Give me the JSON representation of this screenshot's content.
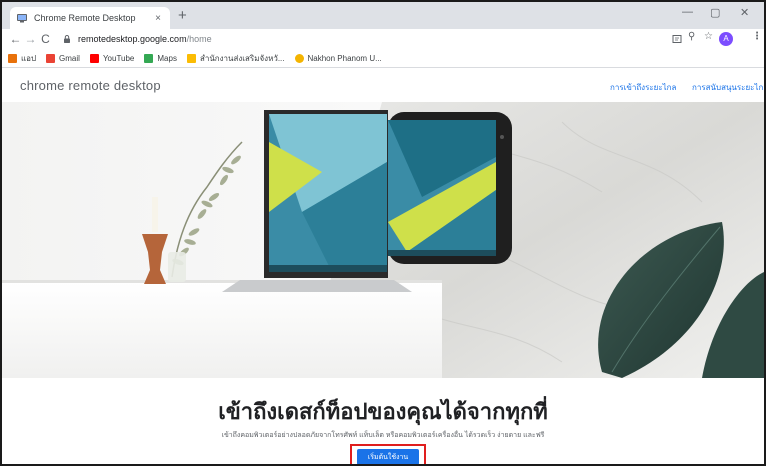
{
  "browser": {
    "tab_title": "Chrome Remote Desktop",
    "tab_close": "×",
    "new_tab": "+",
    "minimize": "—",
    "maximize": "▢",
    "close": "✕",
    "url_host": "remotedesktop.google.com",
    "url_path": "/home",
    "profile_initial": "A"
  },
  "bookmarks": [
    {
      "label": "แอป",
      "icon": "apps-grid-icon",
      "color": "#e8710a"
    },
    {
      "label": "Gmail",
      "icon": "gmail-icon",
      "color": "#ea4335"
    },
    {
      "label": "YouTube",
      "icon": "youtube-icon",
      "color": "#ff0000"
    },
    {
      "label": "Maps",
      "icon": "maps-icon",
      "color": "#34a853"
    },
    {
      "label": "สำนักงานส่งเสริมจังหวั...",
      "icon": "folder-icon",
      "color": "#fbbc04"
    },
    {
      "label": "Nakhon Phanom U...",
      "icon": "site-icon",
      "color": "#f4b400"
    }
  ],
  "header": {
    "logo": "chrome remote desktop",
    "nav": [
      "การเข้าถึงระยะไกล",
      "การสนับสนุนระยะไกล"
    ]
  },
  "hero": {
    "device_screen_colors": [
      "#3a8ca6",
      "#7fc4d4",
      "#cfe04a",
      "#1e6f86"
    ]
  },
  "main": {
    "headline": "เข้าถึงเดสก์ท็อปของคุณได้จากทุกที่",
    "subtext": "เข้าถึงคอมพิวเตอร์อย่างปลอดภัยจากโทรศัพท์ แท็บเล็ต หรือคอมพิวเตอร์เครื่องอื่น ได้รวดเร็ว ง่ายดาย และฟรี",
    "cta_label": "เริ่มต้นใช้งาน"
  },
  "colors": {
    "accent": "#1a73e8",
    "highlight": "#e01e1e"
  }
}
